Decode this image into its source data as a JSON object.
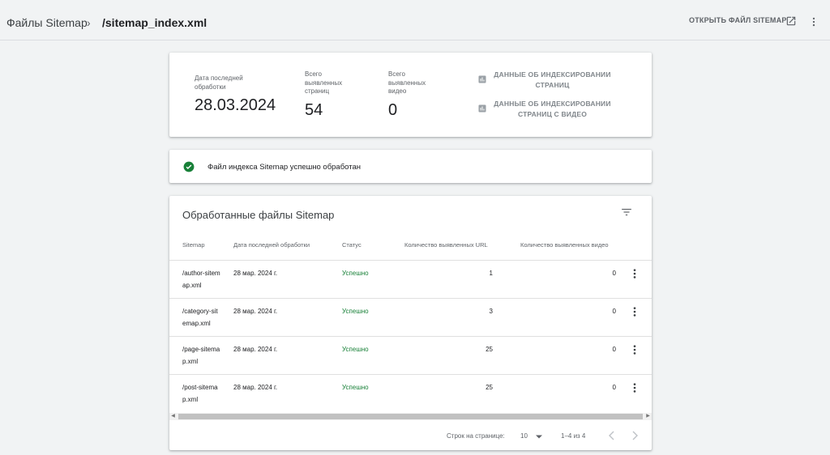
{
  "header": {
    "breadcrumb_root": "Файлы Sitemap",
    "breadcrumb_separator": "›",
    "breadcrumb_current": "/sitemap_index.xml",
    "open_button": "ОТКРЫТЬ ФАЙЛ SITEMAP",
    "open_icon": "open-in-new-icon",
    "menu_icon": "more-vert-icon"
  },
  "summary": {
    "last_processed_label": "Дата последней обработки",
    "last_processed_value": "28.03.2024",
    "pages_label": "Всего выявленных страниц",
    "pages_value": "54",
    "videos_label": "Всего выявленных видео",
    "videos_value": "0",
    "link_pages": "ДАННЫЕ ОБ ИНДЕКСИРОВАНИИ СТРАНИЦ",
    "link_videos": "ДАННЫЕ ОБ ИНДЕКСИРОВАНИИ СТРАНИЦ С ВИДЕО",
    "link_icon": "bar-chart-icon"
  },
  "status": {
    "text": "Файл индекса Sitemap успешно обработан",
    "icon": "check-circle-icon",
    "color": "#188038"
  },
  "table": {
    "title": "Обработанные файлы Sitemap",
    "filter_icon": "filter-list-icon",
    "columns": [
      "Sitemap",
      "Дата последней обработки",
      "Статус",
      "Количество выявленных URL",
      "Количество выявленных видео"
    ],
    "rows": [
      {
        "sitemap": "/author-sitemap.xml",
        "date": "28 мар. 2024 г.",
        "status": "Успешно",
        "urls": "1",
        "videos": "0"
      },
      {
        "sitemap": "/category-sitemap.xml",
        "date": "28 мар. 2024 г.",
        "status": "Успешно",
        "urls": "3",
        "videos": "0"
      },
      {
        "sitemap": "/page-sitemap.xml",
        "date": "28 мар. 2024 г.",
        "status": "Успешно",
        "urls": "25",
        "videos": "0"
      },
      {
        "sitemap": "/post-sitemap.xml",
        "date": "28 мар. 2024 г.",
        "status": "Успешно",
        "urls": "25",
        "videos": "0"
      }
    ],
    "pagination": {
      "rows_per_page_label": "Строк на странице:",
      "rows_per_page": "10",
      "range": "1–4 из 4"
    }
  }
}
